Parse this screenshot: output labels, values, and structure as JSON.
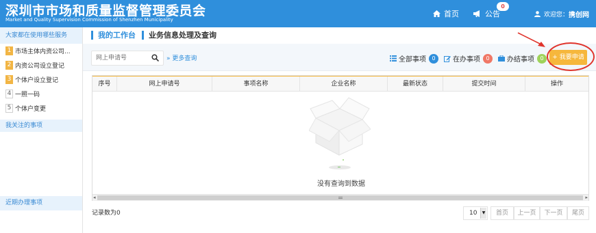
{
  "header": {
    "title_cn": "深圳市市场和质量监督管理委员会",
    "title_en": "Market and Quality Supervision Commission of Shenzhen Municipality",
    "home_label": "首页",
    "notice_label": "公告",
    "notice_count": "0",
    "welcome_label": "欢迎您：",
    "user_name": "携创网"
  },
  "sidebar": {
    "header_label": "大家都在使用哪些服务",
    "items": [
      {
        "num": "1",
        "label": "市场主体内资公司..."
      },
      {
        "num": "2",
        "label": "内资公司设立登记"
      },
      {
        "num": "3",
        "label": "个体户设立登记"
      },
      {
        "num": "4",
        "label": "一照一码"
      },
      {
        "num": "5",
        "label": "个体户变更"
      }
    ],
    "watch_label": "我关注的事项",
    "recent_label": "近期办理事项"
  },
  "breadcrumb": {
    "workspace": "我的工作台",
    "current": "业务信息处理及查询"
  },
  "toolbar": {
    "search_placeholder": "网上申请号",
    "more_query": "更多查询",
    "filters": [
      {
        "label": "全部事项",
        "count": "0"
      },
      {
        "label": "在办事项",
        "count": "0"
      },
      {
        "label": "办结事项",
        "count": "0"
      }
    ],
    "apply_label": "+ 我要申请"
  },
  "table": {
    "columns": [
      "序号",
      "网上申请号",
      "事项名称",
      "企业名称",
      "最新状态",
      "提交时间",
      "操作"
    ],
    "empty_text": "没有查询到数据"
  },
  "footer": {
    "record_label": "记录数为0",
    "page_size": "10",
    "first": "首页",
    "prev": "上一页",
    "next": "下一页",
    "last": "尾页"
  },
  "colors": {
    "brand_blue": "#2f8fdc",
    "accent_orange": "#f6b73c",
    "annotation_red": "#e0342c"
  }
}
